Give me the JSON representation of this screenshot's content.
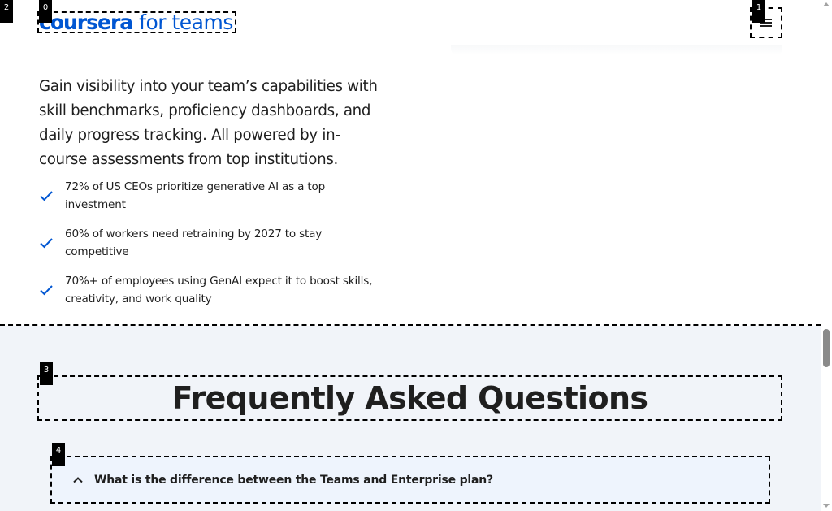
{
  "header": {
    "logo_main": "coursera",
    "logo_sub": "for teams",
    "menu_icon": "hamburger-menu-icon"
  },
  "markers": {
    "m0": "0",
    "m1": "1",
    "m2": "2",
    "m3": "3",
    "m4": "4"
  },
  "content": {
    "intro": "Gain visibility into your team’s capabilities with skill benchmarks, proficiency dashboards, and daily progress tracking. All powered by in-course assessments from top institutions.",
    "stats": [
      {
        "text": "72% of US CEOs prioritize generative AI as a top investment",
        "icon": "check-icon"
      },
      {
        "text": "60% of workers need retraining by 2027 to stay competitive",
        "icon": "check-icon"
      },
      {
        "text": "70%+ of employees using GenAI expect it to boost skills, creativity, and work quality",
        "icon": "check-icon"
      }
    ]
  },
  "faq": {
    "title": "Frequently Asked Questions",
    "items": [
      {
        "question": "What is the difference between the Teams and Enterprise plan?",
        "icon": "chevron-up-icon",
        "expanded": true
      }
    ]
  },
  "colors": {
    "brand": "#0056d2",
    "check": "#0056d2",
    "faq_bg": "#f1f4f9",
    "faq_item_bg": "#eef4fd"
  }
}
